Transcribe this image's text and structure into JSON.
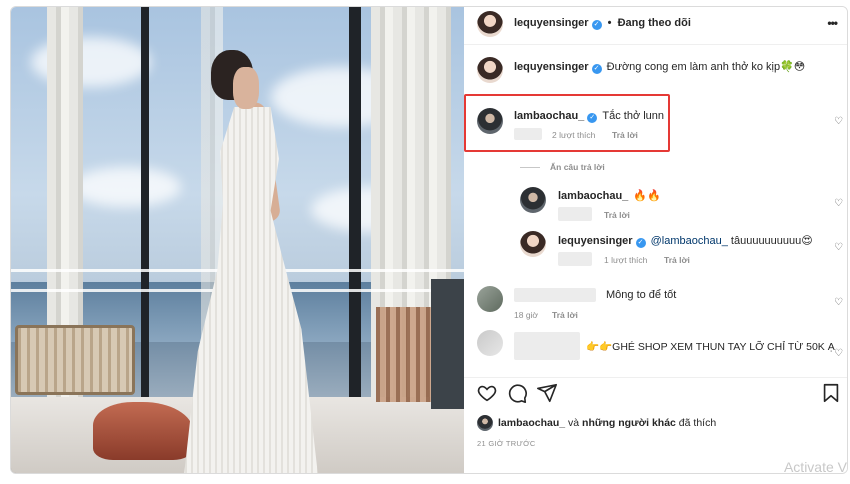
{
  "header": {
    "username": "lequyensinger",
    "separator": "•",
    "follow_status": "Đang theo dõi",
    "more": "•••"
  },
  "caption": {
    "username": "lequyensinger",
    "text": "Đường cong em làm anh thở ko kịp🍀😳"
  },
  "comment_highlighted": {
    "username": "lambaochau_",
    "text": "Tắc thở lunn",
    "likes": "2 lượt thích",
    "reply": "Trả lời"
  },
  "hide_replies": "Ẩn câu trả lời",
  "replies": [
    {
      "username": "lambaochau_",
      "text": "🔥🔥",
      "likes": "",
      "reply": "Trả lời"
    },
    {
      "username": "lequyensinger",
      "mention": "@lambaochau_",
      "text": " tâuuuuuuuuuu😍",
      "likes": "1 lượt thích",
      "reply": "Trả lời"
    }
  ],
  "comment_3": {
    "text": "Mông to để tốt",
    "time": "18 giờ",
    "reply": "Trả lời"
  },
  "comment_4": {
    "text": "👉👉GHÉ SHOP XEM THUN TAY LỠ CHỈ TỪ 50K Ạ"
  },
  "likes_line": {
    "username": "lambaochau_",
    "and": " và ",
    "others": "những người khác",
    "suffix": " đã thích"
  },
  "timestamp": "21 GIỜ TRƯỚC",
  "watermark": "Activate V",
  "colors": {
    "verified": "#3897f0",
    "highlight": "#e53935",
    "meta": "#8e8e8e"
  },
  "icons": [
    "heart-icon",
    "comment-icon",
    "share-icon",
    "bookmark-icon",
    "more-icon"
  ]
}
